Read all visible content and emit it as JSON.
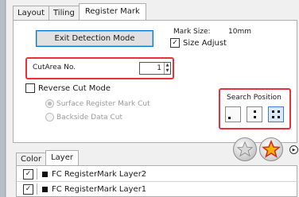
{
  "tabs": [
    "Layout",
    "Tiling",
    "Register Mark"
  ],
  "active_tab": "Register Mark",
  "register_mark": {
    "exit_button": "Exit Detection Mode",
    "mark_size_label": "Mark Size:",
    "mark_size_value": "10mm",
    "size_adjust_label": "Size Adjust",
    "size_adjust_checked": true,
    "cutarea_label": "CutArea No.",
    "cutarea_value": "1",
    "reverse_cut_label": "Reverse Cut Mode",
    "reverse_cut_checked": false,
    "radio_options": [
      "Surface Register Mark Cut",
      "Backside Data Cut"
    ],
    "radio_selected": "Surface Register Mark Cut",
    "search_position_label": "Search Position",
    "search_positions": [
      "1-point",
      "2-point",
      "4-point"
    ],
    "search_position_selected": "4-point"
  },
  "bottom_tabs": [
    "Color",
    "Layer"
  ],
  "bottom_active_tab": "Layer",
  "layers": [
    {
      "name": "FC RegisterMark Layer2",
      "checked": true
    },
    {
      "name": "FC RegisterMark Layer1",
      "checked": true
    }
  ],
  "colors": {
    "highlight": "#e8313b",
    "focus": "#0078d7",
    "star": "#f5b400"
  },
  "icons": [
    "star-gray-icon",
    "star-color-icon",
    "expand-arrow-icon",
    "check-icon",
    "spin-up-icon",
    "spin-down-icon"
  ]
}
